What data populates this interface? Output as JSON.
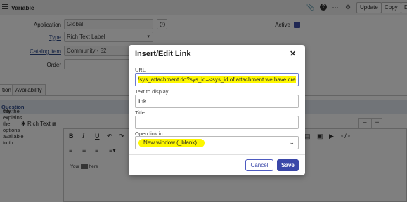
{
  "topbar": {
    "title": "Variable",
    "buttons": {
      "update": "Update",
      "copy": "Copy",
      "delete_partial": "D"
    },
    "icons": [
      "paperclip-icon",
      "help-icon",
      "more-icon",
      "settings-icon"
    ]
  },
  "form": {
    "application_label": "Application",
    "application_value": "Global",
    "type_label": "Type",
    "type_value": "Rich Text Label",
    "catalog_item_label": "Catalog item",
    "catalog_item_value": "Community - 52",
    "order_label": "Order",
    "order_value": "",
    "active_label": "Active"
  },
  "tabs": {
    "question_partial": "tion",
    "availability": "Availability"
  },
  "hint": {
    "prefix": "cify the ",
    "bold": "Question",
    "suffix": " that explains the options available to th"
  },
  "rich_text": {
    "label": "Rich Text",
    "editor_text_before": "Your ",
    "editor_text_highlight": "link",
    "editor_text_after": " here"
  },
  "dialog": {
    "title": "Insert/Edit Link",
    "close": "✕",
    "url_label": "URL",
    "url_value": "/sys_attachment.do?sys_id=<sys_id of attachment we have cre",
    "text_label": "Text to display",
    "text_value": "link",
    "title_label": "Title",
    "title_value": "",
    "open_in_label": "Open link in...",
    "open_in_value": "New window (_blank)",
    "cancel_label": "Cancel",
    "save_label": "Save"
  },
  "colors": {
    "accent": "#3a47a8",
    "highlight": "#fdf700"
  }
}
